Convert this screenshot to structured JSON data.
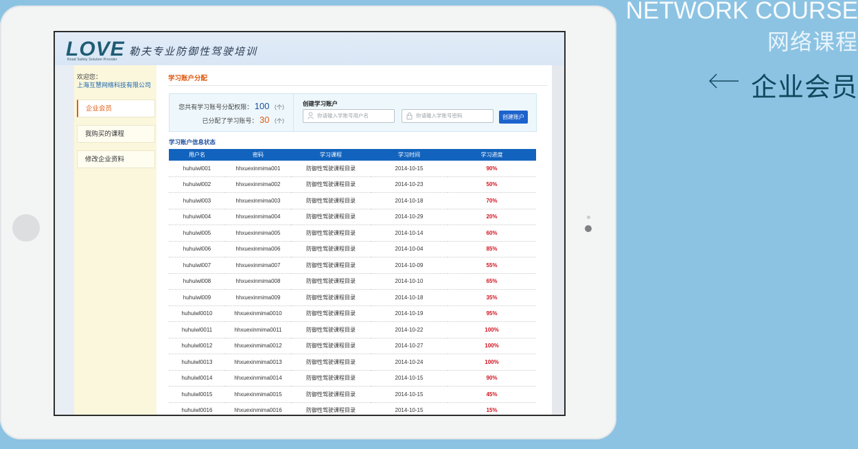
{
  "promo": {
    "title_en": "NETWORK COURSE",
    "title_cn": "网络课程",
    "section": "企业会员"
  },
  "header": {
    "logo": "LOVE",
    "logo_sub": "Road Safety Solution Provider",
    "tagline": "勒夫专业防御性驾驶培训"
  },
  "sidebar": {
    "welcome": "欢迎您：",
    "company": "上海互慧网络科技有限公司",
    "items": [
      {
        "label": "企业会员"
      },
      {
        "label": "我购买的课程"
      },
      {
        "label": "修改企业资料"
      }
    ]
  },
  "allocation": {
    "title": "学习账户分配",
    "total_label": "您共有学习账号分配权限：",
    "total_value": "100",
    "allocated_label": "已分配了学习账号：",
    "allocated_value": "30",
    "unit": "（个）",
    "create_label": "创建学习账户",
    "username_placeholder": "你请输入学账号用户名",
    "password_placeholder": "你请输入学账号密码",
    "create_button": "创建账户"
  },
  "table": {
    "title": "学习账户信息状态",
    "columns": [
      "用户名",
      "密码",
      "学习课程",
      "学习时间",
      "学习进度"
    ],
    "rows": [
      [
        "huhuiwl001",
        "hhxuexinmima001",
        "防御性驾驶课程目录",
        "2014-10-15",
        "90%"
      ],
      [
        "huhuiwl002",
        "hhxuexinmima002",
        "防御性驾驶课程目录",
        "2014-10-23",
        "50%"
      ],
      [
        "huhuiwl003",
        "hhxuexinmima003",
        "防御性驾驶课程目录",
        "2014-10-18",
        "70%"
      ],
      [
        "huhuiwl004",
        "hhxuexinmima004",
        "防御性驾驶课程目录",
        "2014-10-29",
        "20%"
      ],
      [
        "huhuiwl005",
        "hhxuexinmima005",
        "防御性驾驶课程目录",
        "2014-10-14",
        "60%"
      ],
      [
        "huhuiwl006",
        "hhxuexinmima006",
        "防御性驾驶课程目录",
        "2014-10-04",
        "85%"
      ],
      [
        "huhuiwl007",
        "hhxuexinmima007",
        "防御性驾驶课程目录",
        "2014-10-09",
        "55%"
      ],
      [
        "huhuiwl008",
        "hhxuexinmima008",
        "防御性驾驶课程目录",
        "2014-10-10",
        "65%"
      ],
      [
        "huhuiwl009",
        "hhxuexinmima009",
        "防御性驾驶课程目录",
        "2014-10-18",
        "35%"
      ],
      [
        "huhuiwl0010",
        "hhxuexinmima0010",
        "防御性驾驶课程目录",
        "2014-10-19",
        "95%"
      ],
      [
        "huhuiwl0011",
        "hhxuexinmima0011",
        "防御性驾驶课程目录",
        "2014-10-22",
        "100%"
      ],
      [
        "huhuiwl0012",
        "hhxuexinmima0012",
        "防御性驾驶课程目录",
        "2014-10-27",
        "100%"
      ],
      [
        "huhuiwl0013",
        "hhxuexinmima0013",
        "防御性驾驶课程目录",
        "2014-10-24",
        "100%"
      ],
      [
        "huhuiwl0014",
        "hhxuexinmima0014",
        "防御性驾驶课程目录",
        "2014-10-15",
        "90%"
      ],
      [
        "huhuiwl0015",
        "hhxuexinmima0015",
        "防御性驾驶课程目录",
        "2014-10-15",
        "45%"
      ],
      [
        "huhuiwl0016",
        "hhxuexinmima0016",
        "防御性驾驶课程目录",
        "2014-10-15",
        "15%"
      ]
    ]
  },
  "colors": {
    "background": "#8cc3e3",
    "accent_orange": "#e25a10",
    "header_blue": "#1263bd",
    "progress_red": "#d0101c"
  },
  "icons": [
    "user-icon",
    "lock-icon",
    "arrow-left-icon"
  ]
}
